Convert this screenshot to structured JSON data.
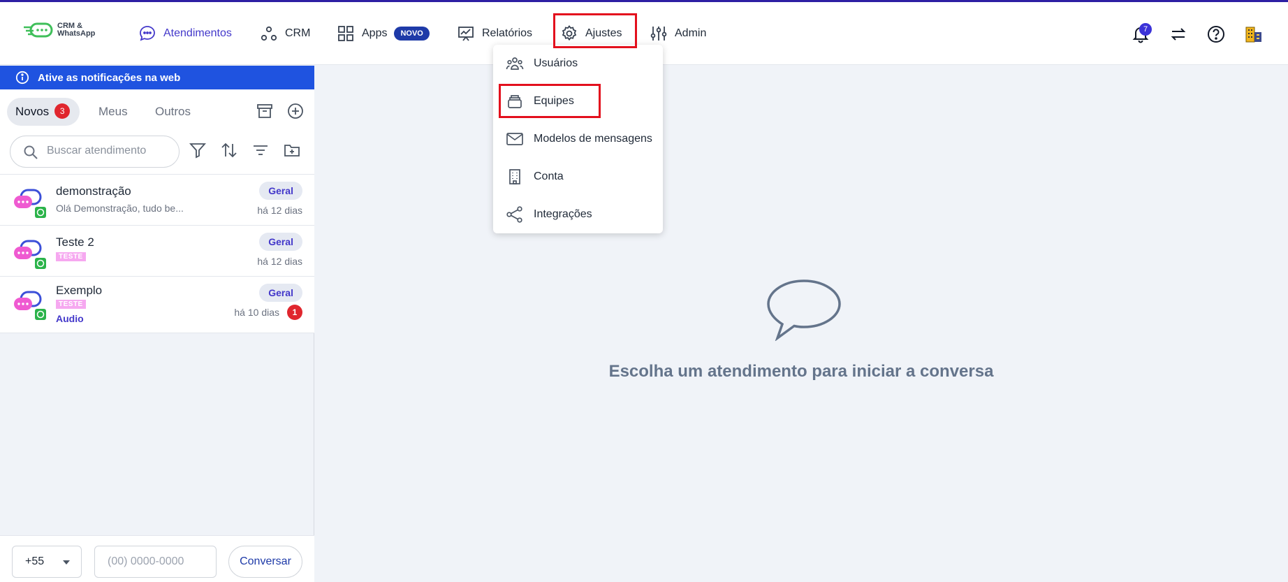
{
  "app": {
    "logo_line1": "CRM &",
    "logo_line2": "WhatsApp"
  },
  "nav": {
    "atendimentos": "Atendimentos",
    "crm": "CRM",
    "apps": "Apps",
    "apps_badge": "NOVO",
    "relatorios": "Relatórios",
    "ajustes": "Ajustes",
    "admin": "Admin"
  },
  "header": {
    "notifications_count": "7"
  },
  "banner": {
    "text": "Ative as notificações na web"
  },
  "tabs": {
    "novos": "Novos",
    "novos_count": "3",
    "meus": "Meus",
    "outros": "Outros"
  },
  "search": {
    "placeholder": "Buscar atendimento"
  },
  "conversations": [
    {
      "name": "demonstração",
      "preview": "Olá Demonstração, tudo be...",
      "team": "Geral",
      "date": "há 12 dias"
    },
    {
      "name": "Teste 2",
      "tag": "TESTE",
      "team": "Geral",
      "date": "há 12 dias"
    },
    {
      "name": "Exemplo",
      "tag": "TESTE",
      "preview": "Audio",
      "team": "Geral",
      "date": "há 10 dias",
      "unread": "1"
    }
  ],
  "composer": {
    "ddi": "+55",
    "phone_placeholder": "(00) 0000-0000",
    "button": "Conversar"
  },
  "empty_state": {
    "text": "Escolha um atendimento para iniciar a conversa"
  },
  "ajustes_menu": [
    {
      "label": "Usuários"
    },
    {
      "label": "Equipes"
    },
    {
      "label": "Modelos de mensagens"
    },
    {
      "label": "Conta"
    },
    {
      "label": "Integrações"
    }
  ],
  "colors": {
    "accent": "#4338ca",
    "banner": "#1f53e0",
    "badge_red": "#e0262e",
    "highlight_box": "#e3101d",
    "tag_pink": "#f6a8f0"
  }
}
